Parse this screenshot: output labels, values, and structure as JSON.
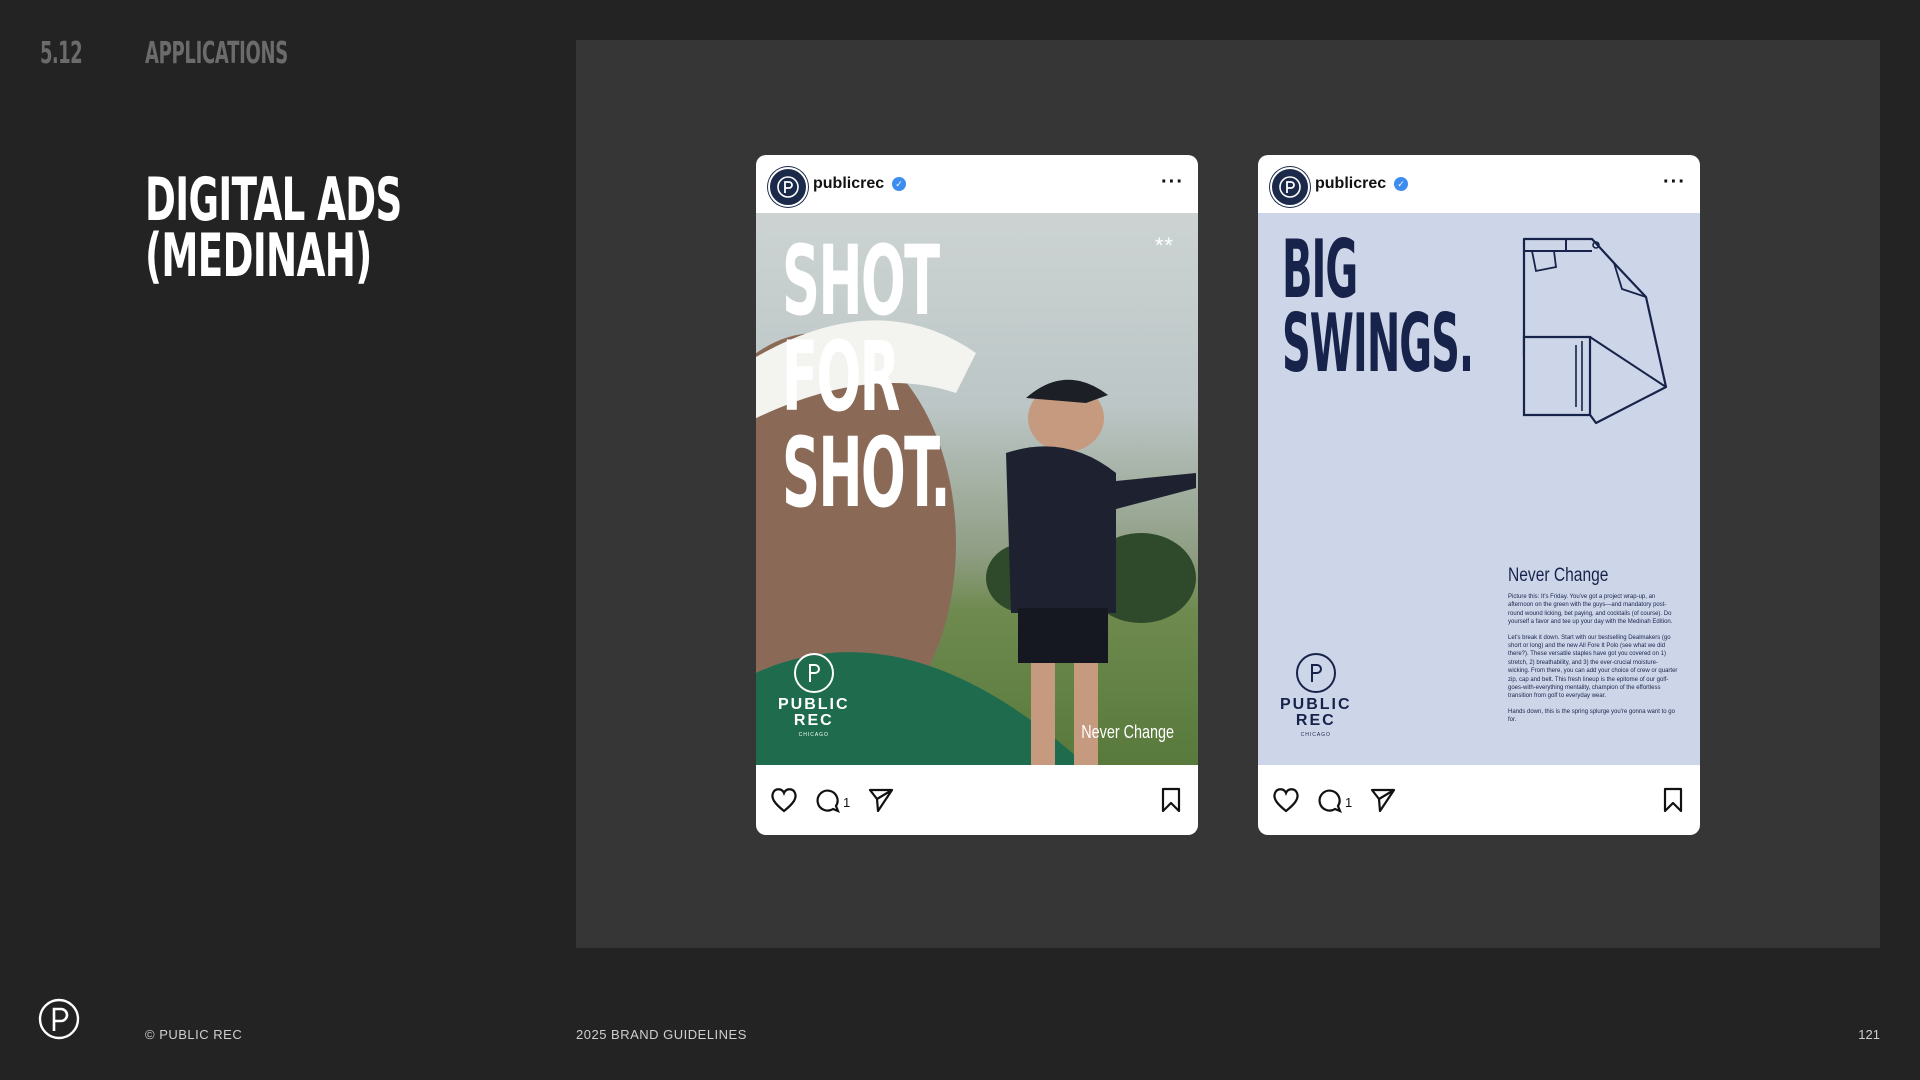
{
  "header": {
    "section_number": "5.12",
    "section_name": "APPLICATIONS"
  },
  "title": {
    "line1": "DIGITAL ADS",
    "line2": "(MEDINAH)"
  },
  "posts": [
    {
      "handle": "publicrec",
      "headline": [
        "SHOT",
        "FOR",
        "SHOT."
      ],
      "stars": "**",
      "tagline": "Never Change",
      "logo_line1": "PUBLIC",
      "logo_line2": "REC",
      "logo_sub": "CHICAGO",
      "comment_count": "1"
    },
    {
      "handle": "publicrec",
      "headline": [
        "BIG",
        "SWINGS."
      ],
      "tagline": "Never Change",
      "body": [
        "Picture this: It's Friday. You've got a project wrap-up, an afternoon on the green with the guys—and mandatory post-round wound licking, bet paying, and cocktails (of course). Do yourself a favor and tee up your day with the Medinah Edition.",
        "Let's break it down. Start with our bestselling Dealmakers (go short or long) and the new All Fore It Polo (see what we did there?). These versatile staples have got you covered on 1) stretch, 2) breathability, and 3) the ever-crucial moisture-wicking. From there, you can add your choice of crew or quarter zip, cap and belt. This fresh lineup is the epitome of our golf-goes-with-everything mentality, champion of the effortless transition from golf to everyday wear.",
        "Hands down, this is the spring splurge you're gonna want to go for."
      ],
      "logo_line1": "PUBLIC",
      "logo_line2": "REC",
      "logo_sub": "CHICAGO",
      "comment_count": "1"
    }
  ],
  "footer": {
    "copyright": "© PUBLIC REC",
    "doc_title": "2025 BRAND GUIDELINES",
    "page_number": "121"
  }
}
